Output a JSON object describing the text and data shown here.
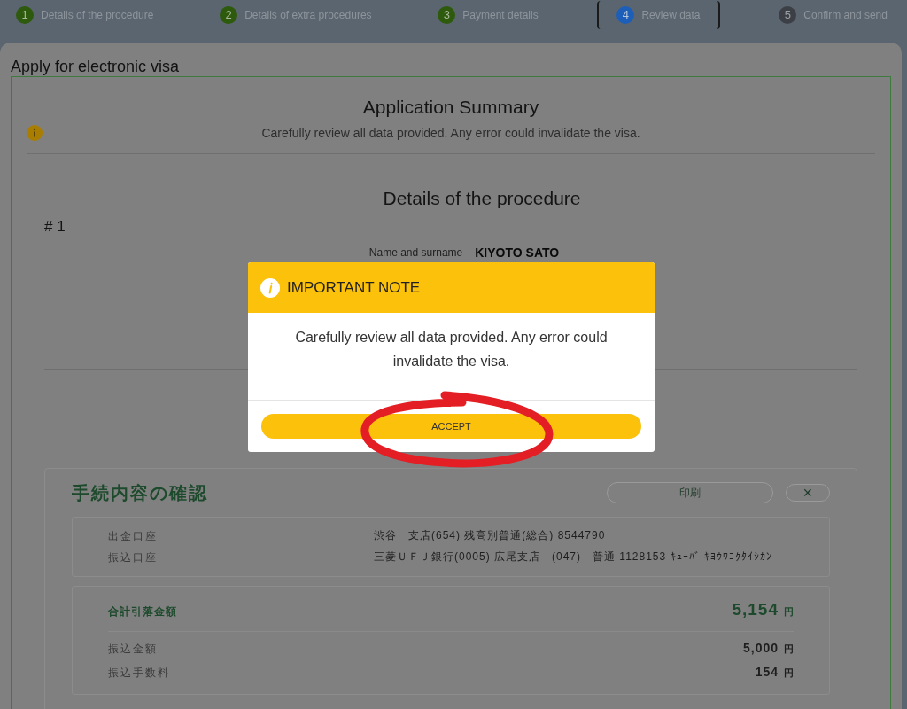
{
  "steps": [
    {
      "number": "1",
      "label": "Details of the procedure",
      "kind": "done"
    },
    {
      "number": "2",
      "label": "Details of extra procedures",
      "kind": "done"
    },
    {
      "number": "3",
      "label": "Payment details",
      "kind": "done"
    },
    {
      "number": "4",
      "label": "Review data",
      "kind": "current"
    },
    {
      "number": "5",
      "label": "Confirm and send",
      "kind": "pending"
    }
  ],
  "page_title": "Apply for electronic visa",
  "summary": {
    "title": "Application Summary",
    "notice": "Carefully review all data provided. Any error could invalidate the visa."
  },
  "procedure": {
    "title": "Details of the procedure",
    "index": "# 1",
    "fields": [
      {
        "label": "Name and surname",
        "value": "KIYOTO SATO"
      }
    ]
  },
  "bank_screenshot": {
    "title": "手続内容の確認",
    "print_button": "印刷",
    "close_button": "✕",
    "accounts": [
      {
        "label": "出金口座",
        "value": "渋谷　支店(654) 残高別普通(総合) 8544790"
      },
      {
        "label": "振込口座",
        "value": "三菱ＵＦＪ銀行(0005) 広尾支店　(047)　普通 1128153 ｷｭｰﾊﾞ ｷﾖｳﾜｺｸﾀｲｼｶﾝ"
      }
    ],
    "total": {
      "label": "合計引落金額",
      "amount": "5,154",
      "unit": "円"
    },
    "lines": [
      {
        "label": "振込金額",
        "amount": "5,000",
        "unit": "円"
      },
      {
        "label": "振込手数料",
        "amount": "154",
        "unit": "円"
      }
    ]
  },
  "modal": {
    "title": "IMPORTANT NOTE",
    "message": "Carefully review all data provided. Any error could invalidate the visa.",
    "button": "ACCEPT"
  }
}
